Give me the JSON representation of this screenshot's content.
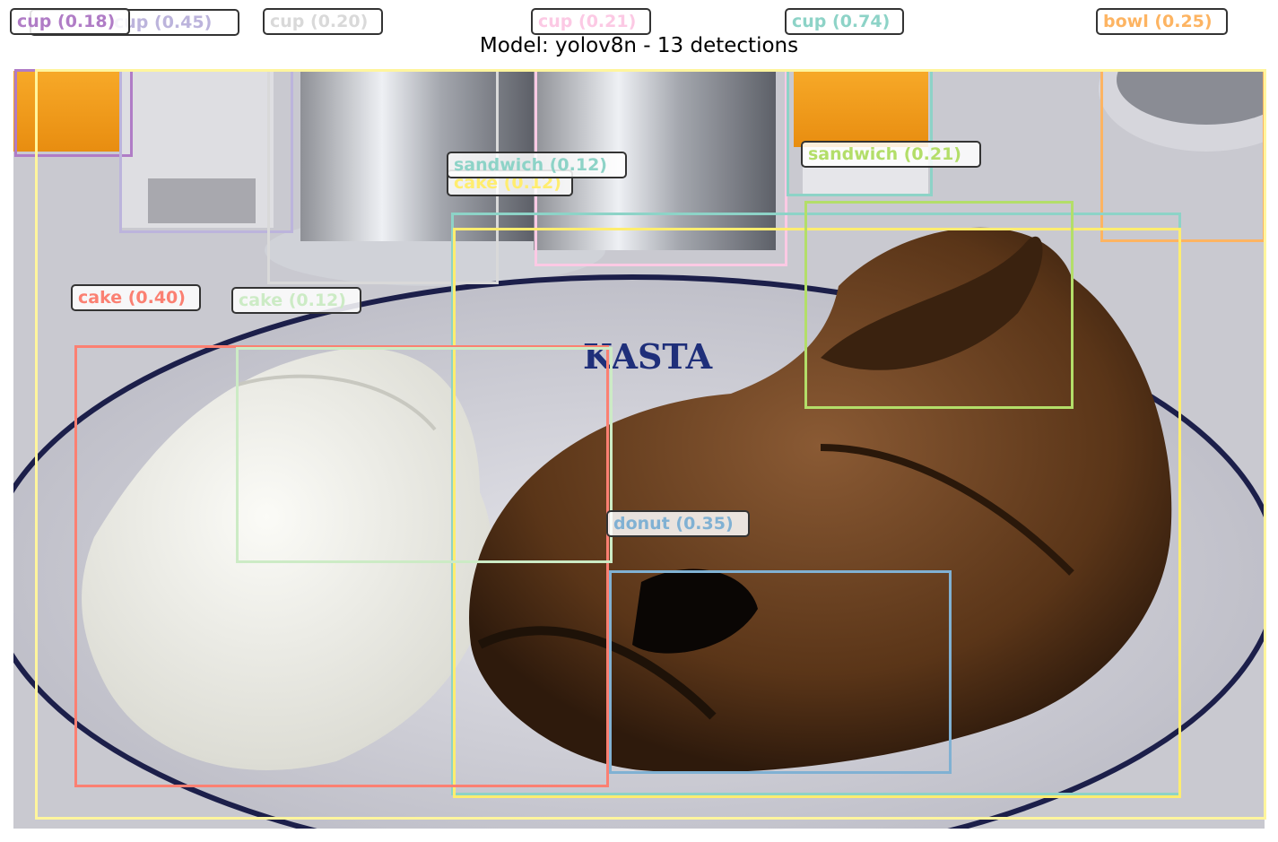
{
  "title": "Model: yolov8n - 13 detections",
  "detections": [
    {
      "label": "cup (0.18)",
      "color": "#b07cc6"
    },
    {
      "label": "cup (0.45)",
      "color": "#bcb4dc"
    },
    {
      "label": "cup (0.20)",
      "color": "#d9d9d9"
    },
    {
      "label": "cup (0.21)",
      "color": "#fcc9e4"
    },
    {
      "label": "cup (0.74)",
      "color": "#8dd3c7"
    },
    {
      "label": "bowl (0.25)",
      "color": "#fdb462"
    },
    {
      "label": "sandwich (0.12)",
      "color": "#8dd3c7"
    },
    {
      "label": "cake (0.12)",
      "color": "#ffed6f"
    },
    {
      "label": "sandwich (0.21)",
      "color": "#b3de69"
    },
    {
      "label": "cake (0.40)",
      "color": "#fb8072"
    },
    {
      "label": "cake (0.12)",
      "color": "#ccebc5"
    },
    {
      "label": "donut (0.35)",
      "color": "#80b1d3"
    },
    {
      "label": "",
      "color": "#fff59d"
    }
  ]
}
